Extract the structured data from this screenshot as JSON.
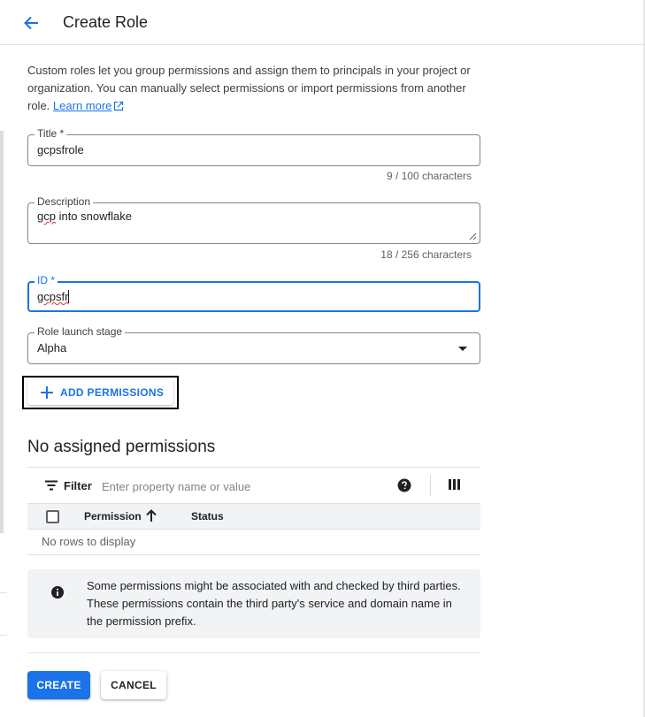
{
  "header": {
    "title": "Create Role",
    "back_icon": "arrow-left-icon"
  },
  "intro": {
    "text": "Custom roles let you group permissions and assign them to principals in your project or organization. You can manually select permissions or import permissions from another role.",
    "learn_more": "Learn more",
    "link_icon": "external-link-icon"
  },
  "fields": {
    "title": {
      "label": "Title *",
      "value": "gcpsfrole",
      "counter": "9 / 100 characters"
    },
    "description": {
      "label": "Description",
      "value_word1": "gcp",
      "value_rest": " into snowflake",
      "counter": "18 / 256 characters"
    },
    "id": {
      "label": "ID *",
      "value": "gcpsfr"
    },
    "launch_stage": {
      "label": "Role launch stage",
      "value": "Alpha"
    }
  },
  "add_permissions": {
    "label": "ADD PERMISSIONS",
    "icon": "plus-icon"
  },
  "permissions": {
    "title": "No assigned permissions",
    "filter_label": "Filter",
    "filter_placeholder": "Enter property name or value",
    "columns": [
      "Permission",
      "Status"
    ],
    "empty_text": "No rows to display"
  },
  "info": {
    "text": "Some permissions might be associated with and checked by third parties. These permissions contain the third party's service and domain name in the permission prefix."
  },
  "actions": {
    "create": "CREATE",
    "cancel": "CANCEL"
  },
  "colors": {
    "accent": "#1a73e8",
    "text": "#202124",
    "muted": "#5f6368"
  }
}
